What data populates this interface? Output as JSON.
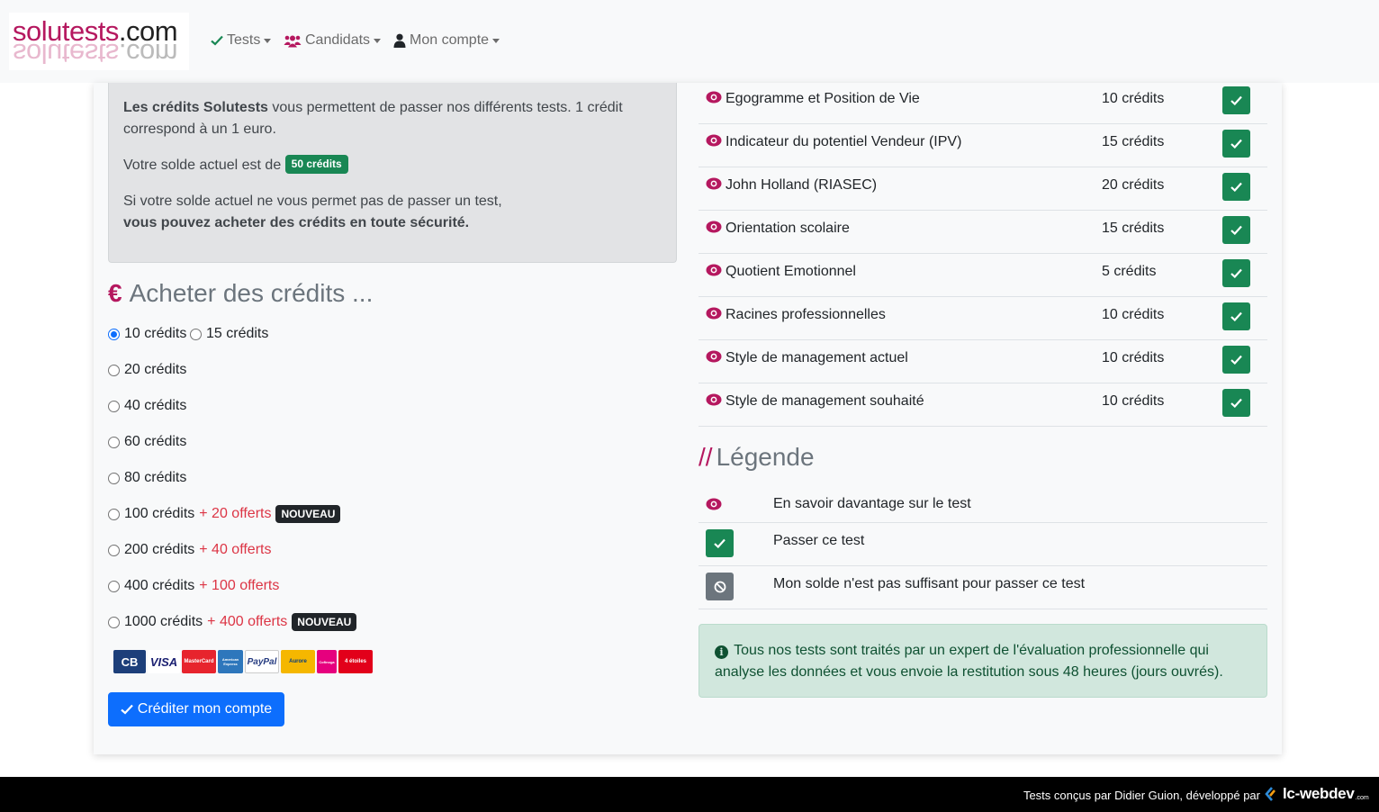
{
  "navbar": {
    "logo": {
      "part1": "solutests",
      "part2": ".com"
    },
    "items": [
      {
        "label": "Tests",
        "icon": "check-icon"
      },
      {
        "label": "Candidats",
        "icon": "users-icon"
      },
      {
        "label": "Mon compte",
        "icon": "user-icon"
      }
    ]
  },
  "info": {
    "line1_bold": "Les crédits Solutests",
    "line1_rest": " vous permettent de passer nos différents tests. 1 crédit",
    "line2": "correspond à un 1 euro.",
    "balance_prefix": "Votre solde actuel est de ",
    "balance_badge": "50 crédits",
    "line4": "Si votre solde actuel ne vous permet pas de passer un test,",
    "line5": "vous pouvez acheter des crédits en toute sécurité."
  },
  "buy": {
    "title_icon": "€",
    "title": "Acheter des crédits ...",
    "options": [
      {
        "label": "10 crédits",
        "bonus": "",
        "badge": "",
        "checked": true
      },
      {
        "label": "15 crédits",
        "bonus": "",
        "badge": "",
        "checked": false
      },
      {
        "label": "20 crédits",
        "bonus": "",
        "badge": "",
        "checked": false
      },
      {
        "label": "40 crédits",
        "bonus": "",
        "badge": "",
        "checked": false
      },
      {
        "label": "60 crédits",
        "bonus": "",
        "badge": "",
        "checked": false
      },
      {
        "label": "80 crédits",
        "bonus": "",
        "badge": "",
        "checked": false
      },
      {
        "label": "100 crédits",
        "bonus": "+ 20 offerts",
        "badge": "NOUVEAU",
        "checked": false
      },
      {
        "label": "200 crédits",
        "bonus": "+ 40 offerts",
        "badge": "",
        "checked": false
      },
      {
        "label": "400 crédits",
        "bonus": "+ 100 offerts",
        "badge": "",
        "checked": false
      },
      {
        "label": "1000 crédits",
        "bonus": "+ 400 offerts",
        "badge": "NOUVEAU",
        "checked": false
      }
    ],
    "payment_logos": [
      "CB",
      "VISA",
      "MasterCard",
      "American Express",
      "PayPal",
      "Aurore",
      "Cofinoga",
      "4 étoiles"
    ],
    "submit_label": "Créditer mon compte"
  },
  "tests": [
    {
      "name": "Egogramme et Position de Vie",
      "cost": "10 crédits"
    },
    {
      "name": "Indicateur du potentiel Vendeur (IPV)",
      "cost": "15 crédits"
    },
    {
      "name": "John Holland (RIASEC)",
      "cost": "20 crédits"
    },
    {
      "name": "Orientation scolaire",
      "cost": "15 crédits"
    },
    {
      "name": "Quotient Emotionnel",
      "cost": "5 crédits"
    },
    {
      "name": "Racines professionnelles",
      "cost": "10 crédits"
    },
    {
      "name": "Style de management actuel",
      "cost": "10 crédits"
    },
    {
      "name": "Style de management souhaité",
      "cost": "10 crédits"
    }
  ],
  "legend": {
    "title_prefix": "//",
    "title": "Légende",
    "items": [
      {
        "icon": "eye-icon",
        "text": "En savoir davantage sur le test"
      },
      {
        "icon": "check-icon",
        "text": "Passer ce test"
      },
      {
        "icon": "ban-icon",
        "text": "Mon solde n'est pas suffisant pour passer ce test"
      }
    ]
  },
  "alert": {
    "line1": "Tous nos tests sont traités par un expert de l'évaluation professionnelle qui",
    "line2": "analyse les données et vous envoie la restitution sous 48 heures (jours ouvrés)."
  },
  "footer": {
    "text": "Tests conçus par Didier Guion, développé par",
    "brand": "lc-webdev",
    "tld": ".com"
  },
  "colors": {
    "brand": "#b5185f",
    "success": "#198754",
    "primary": "#0d6efd",
    "danger": "#dc3545",
    "secondary": "#6c757d"
  }
}
